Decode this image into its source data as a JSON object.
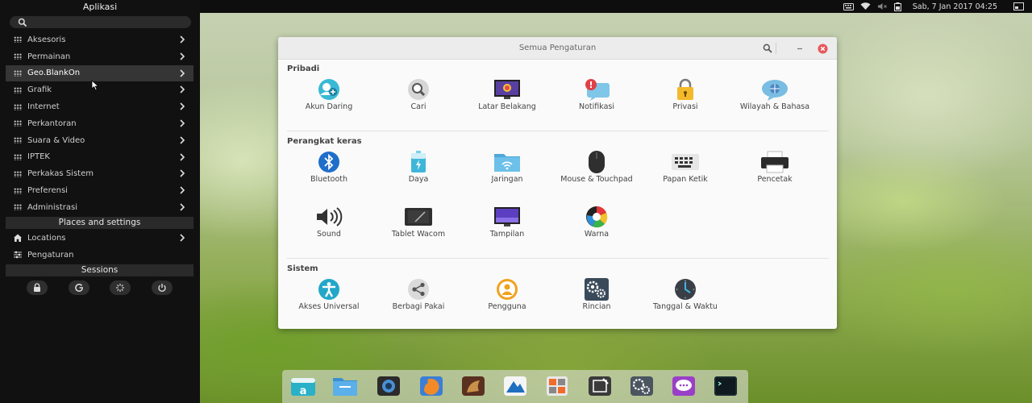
{
  "menu": {
    "title": "Aplikasi",
    "search_placeholder": "",
    "categories": [
      {
        "label": "Aksesoris"
      },
      {
        "label": "Permainan"
      },
      {
        "label": "Geo.BlankOn"
      },
      {
        "label": "Grafik"
      },
      {
        "label": "Internet"
      },
      {
        "label": "Perkantoran"
      },
      {
        "label": "Suara & Video"
      },
      {
        "label": "IPTEK"
      },
      {
        "label": "Perkakas Sistem"
      },
      {
        "label": "Preferensi"
      },
      {
        "label": "Administrasi"
      }
    ],
    "selected_category": "Geo.BlankOn",
    "places_header": "Places and settings",
    "places": [
      {
        "label": "Locations",
        "icon": "home-icon"
      },
      {
        "label": "Pengaturan",
        "icon": "sliders-icon"
      }
    ],
    "sessions_header": "Sessions",
    "session_buttons": [
      "lock-icon",
      "logout-icon",
      "suspend-icon",
      "power-icon"
    ]
  },
  "topbar": {
    "clock": "Sab,  7 Jan 2017 04:25",
    "tray_icons": [
      "keyboard-icon",
      "wifi-icon",
      "volume-muted-icon",
      "battery-icon",
      "display-icon"
    ]
  },
  "window": {
    "title": "Semua Pengaturan",
    "sections": [
      {
        "title": "Pribadi",
        "items": [
          {
            "label": "Akun Daring",
            "icon": "online-accounts-icon"
          },
          {
            "label": "Cari",
            "icon": "search-settings-icon"
          },
          {
            "label": "Latar Belakang",
            "icon": "background-icon"
          },
          {
            "label": "Notifikasi",
            "icon": "notifications-icon"
          },
          {
            "label": "Privasi",
            "icon": "privacy-lock-icon"
          },
          {
            "label": "Wilayah & Bahasa",
            "icon": "region-language-icon"
          }
        ]
      },
      {
        "title": "Perangkat keras",
        "items": [
          {
            "label": "Bluetooth",
            "icon": "bluetooth-icon"
          },
          {
            "label": "Daya",
            "icon": "power-battery-icon"
          },
          {
            "label": "Jaringan",
            "icon": "network-folder-icon"
          },
          {
            "label": "Mouse & Touchpad",
            "icon": "mouse-icon"
          },
          {
            "label": "Papan Ketik",
            "icon": "keyboard-settings-icon"
          },
          {
            "label": "Pencetak",
            "icon": "printer-icon"
          },
          {
            "label": "Sound",
            "icon": "speaker-icon"
          },
          {
            "label": "Tablet Wacom",
            "icon": "tablet-icon"
          },
          {
            "label": "Tampilan",
            "icon": "display-settings-icon"
          },
          {
            "label": "Warna",
            "icon": "color-icon"
          }
        ]
      },
      {
        "title": "Sistem",
        "items": [
          {
            "label": "Akses Universal",
            "icon": "accessibility-icon"
          },
          {
            "label": "Berbagi Pakai",
            "icon": "share-icon"
          },
          {
            "label": "Pengguna",
            "icon": "users-icon"
          },
          {
            "label": "Rincian",
            "icon": "details-gears-icon"
          },
          {
            "label": "Tanggal & Waktu",
            "icon": "clock-icon"
          }
        ]
      }
    ]
  },
  "dock": {
    "items": [
      "software-center-icon",
      "files-icon",
      "webcam-icon",
      "firefox-icon",
      "game-icon",
      "map-icon",
      "calculator-icon",
      "text-editor-icon",
      "system-settings-icon",
      "chat-icon",
      "terminal-icon"
    ]
  }
}
